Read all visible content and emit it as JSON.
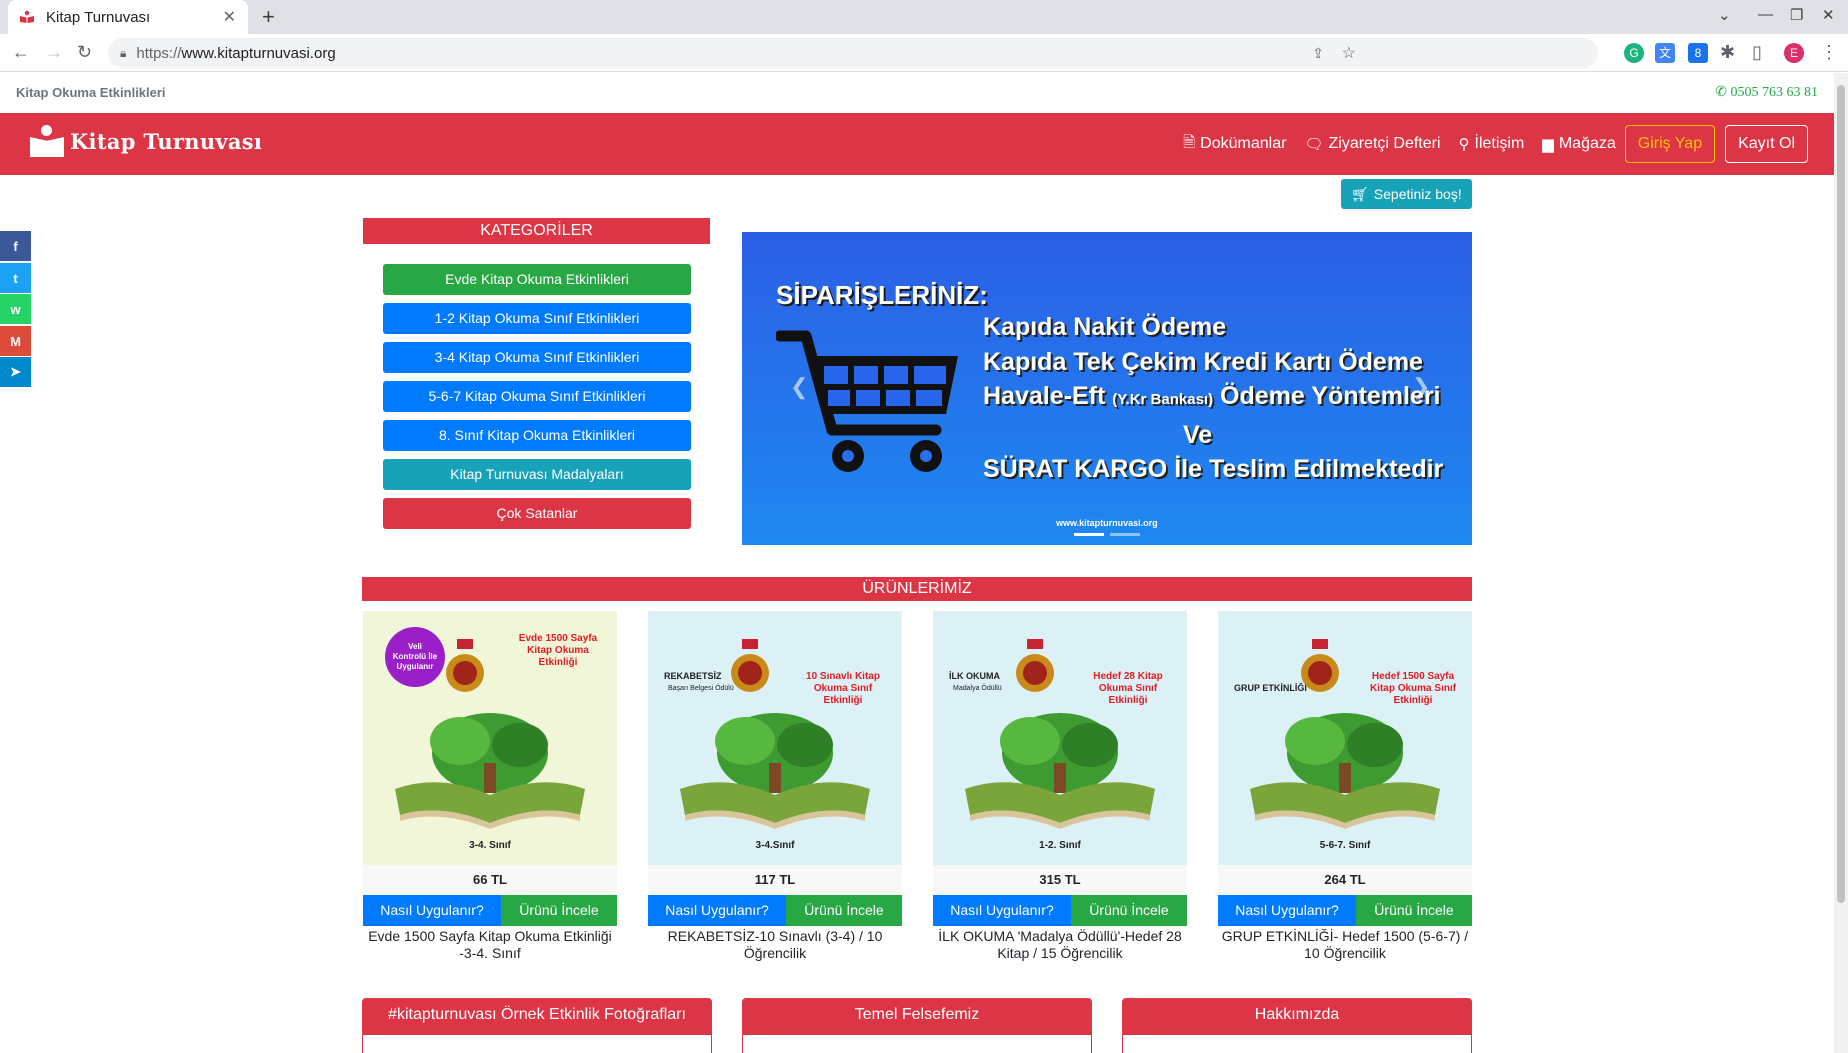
{
  "browser": {
    "tab_title": "Kitap Turnuvası",
    "url_scheme": "https://",
    "url_host": "www.kitapturnuvasi.org",
    "profile_initial": "E",
    "ext_badge": "8"
  },
  "topbar": {
    "site_tagline": "Kitap Okuma Etkinlikleri",
    "phone": "0505 763 63 81"
  },
  "header": {
    "logo_text": "Kitap Turnuvası",
    "nav": [
      {
        "label": "Dokümanlar",
        "icon": "file-icon"
      },
      {
        "label": "Ziyaretçi Defteri",
        "icon": "comment-icon"
      },
      {
        "label": "İletişim",
        "icon": "map-marker-icon"
      },
      {
        "label": "Mağaza",
        "icon": "store-icon"
      }
    ],
    "login_label": "Giriş Yap",
    "register_label": "Kayıt Ol"
  },
  "cart": {
    "label": "Sepetiniz boş!"
  },
  "categories": {
    "title": "KATEGORİLER",
    "items": [
      {
        "label": "Evde Kitap Okuma Etkinlikleri",
        "color": "#28a745"
      },
      {
        "label": "1-2 Kitap Okuma Sınıf Etkinlikleri",
        "color": "#007bff"
      },
      {
        "label": "3-4 Kitap Okuma Sınıf Etkinlikleri",
        "color": "#007bff"
      },
      {
        "label": "5-6-7 Kitap Okuma Sınıf Etkinlikleri",
        "color": "#007bff"
      },
      {
        "label": "8. Sınıf Kitap Okuma Etkinlikleri",
        "color": "#007bff"
      },
      {
        "label": "Kitap Turnuvası Madalyaları",
        "color": "#17a2b8"
      },
      {
        "label": "Çok Satanlar",
        "color": "#dc3545"
      }
    ]
  },
  "slider": {
    "title": "SİPARİŞLERİNİZ:",
    "lines": [
      "Kapıda Nakit Ödeme",
      "Kapıda Tek Çekim Kredi Kartı  Ödeme",
      "Havale-Eft",
      "(Y.Kr Bankası)",
      "Ödeme Yöntemleri",
      "Ve",
      "SÜRAT KARGO İle Teslim Edilmektedir"
    ],
    "watermark": "www.kitapturnuvasi.org"
  },
  "products": {
    "title": "ÜRÜNLERİMİZ",
    "how_label": "Nasıl Uygulanır?",
    "view_label": "Ürünü İncele",
    "items": [
      {
        "price": "66 TL",
        "title": "Evde 1500 Sayfa Kitap Okuma Etkinliği -3-4. Sınıf",
        "img_badge": "Veli Kontrolü İle Uygulanır",
        "img_red": "Evde 1500 Sayfa Kitap Okuma Etkinliği",
        "img_grade": "3-4. Sınıf",
        "bg": "#f2f6d8"
      },
      {
        "price": "117 TL",
        "title": "REKABETSİZ-10 Sınavlı (3-4) / 10 Öğrencilik",
        "img_dark": "REKABETSİZ",
        "img_dark_sub": "Başarı Belgesi Ödülü",
        "img_red": "10 Sınavlı Kitap Okuma Sınıf Etkinliği",
        "img_grade": "3-4.Sınıf",
        "bg": "#dcf1f6"
      },
      {
        "price": "315 TL",
        "title": "İLK OKUMA 'Madalya Ödüllü'-Hedef 28 Kitap / 15 Öğrencilik",
        "img_dark": "İLK OKUMA",
        "img_dark_sub": "Madalya Ödüllü",
        "img_red": "Hedef 28 Kitap Okuma Sınıf Etkinliği",
        "img_grade": "1-2. Sınıf",
        "bg": "#dcf1f6"
      },
      {
        "price": "264 TL",
        "title": "GRUP ETKİNLİĞİ- Hedef 1500 (5-6-7) / 10 Öğrencilik",
        "img_dark": "GRUP ETKİNLİĞİ",
        "img_red": "Hedef 1500 Sayfa Kitap Okuma Sınıf Etkinliği",
        "img_grade": "5-6-7. Sınıf",
        "bg": "#dcf1f6"
      }
    ]
  },
  "sections": [
    {
      "title": "#kitapturnuvası Örnek Etkinlik Fotoğrafları"
    },
    {
      "title": "Temel Felsefemiz"
    },
    {
      "title": "Hakkımızda"
    }
  ],
  "share": [
    {
      "name": "facebook-icon",
      "glyph": "f",
      "color": "#3b5998"
    },
    {
      "name": "twitter-icon",
      "glyph": "t",
      "color": "#1da1f2"
    },
    {
      "name": "whatsapp-icon",
      "glyph": "w",
      "color": "#25d366"
    },
    {
      "name": "gmail-icon",
      "glyph": "M",
      "color": "#dd4b39"
    },
    {
      "name": "telegram-icon",
      "glyph": "➤",
      "color": "#0088cc"
    }
  ]
}
